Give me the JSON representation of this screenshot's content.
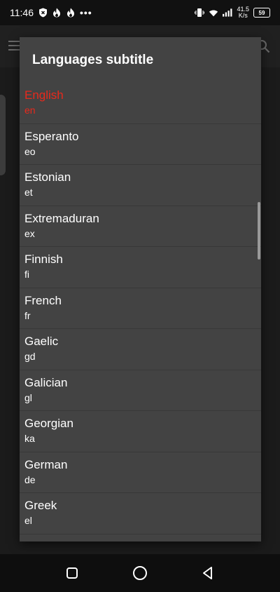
{
  "status_bar": {
    "time": "11:46",
    "dots": "•••",
    "speed_value": "41.5",
    "speed_unit": "K/s",
    "battery": "59"
  },
  "dialog": {
    "title": "Languages subtitle",
    "selected_index": 0,
    "selected_color": "#e8291c",
    "items": [
      {
        "name": "English",
        "code": "en"
      },
      {
        "name": "Esperanto",
        "code": "eo"
      },
      {
        "name": "Estonian",
        "code": "et"
      },
      {
        "name": "Extremaduran",
        "code": "ex"
      },
      {
        "name": "Finnish",
        "code": "fi"
      },
      {
        "name": "French",
        "code": "fr"
      },
      {
        "name": "Gaelic",
        "code": "gd"
      },
      {
        "name": "Galician",
        "code": "gl"
      },
      {
        "name": "Georgian",
        "code": "ka"
      },
      {
        "name": "German",
        "code": "de"
      },
      {
        "name": "Greek",
        "code": "el"
      }
    ]
  },
  "icons": {
    "status_left": [
      "shield-x-icon",
      "fire-icon",
      "fire-icon"
    ],
    "status_right": [
      "vibrate-icon",
      "wifi-icon",
      "signal-icon",
      "battery-icon"
    ],
    "app": [
      "menu-icon",
      "search-icon"
    ],
    "nav": [
      "recent-apps-icon",
      "home-icon",
      "back-icon"
    ]
  }
}
